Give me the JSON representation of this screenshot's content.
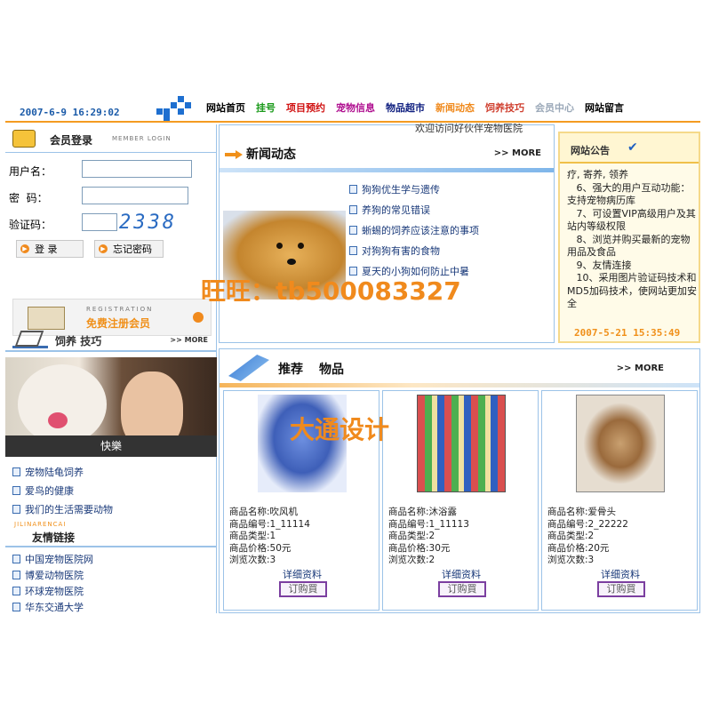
{
  "top": {
    "datetime": "2007-6-9 16:29:02",
    "nav": [
      {
        "label": "网站首页",
        "color": "#000000"
      },
      {
        "label": "挂号",
        "color": "#1a9a1a"
      },
      {
        "label": "项目预约",
        "color": "#d01010"
      },
      {
        "label": "宠物信息",
        "color": "#b01090"
      },
      {
        "label": "物品超市",
        "color": "#102080"
      },
      {
        "label": "新闻动态",
        "color": "#f08a1d"
      },
      {
        "label": "饲养技巧",
        "color": "#d04030"
      },
      {
        "label": "会员中心",
        "color": "#9aa8b8"
      },
      {
        "label": "网站留言",
        "color": "#000000"
      }
    ]
  },
  "login": {
    "title": "会员登录",
    "subtitle": "MEMBER LOGIN",
    "username_label": "用户名：",
    "password_label": "密  码：",
    "captcha_label": "验证码：",
    "captcha_text": "2338",
    "login_button": "登 录",
    "forgot_button": "忘记密码"
  },
  "register": {
    "top": "REGISTRATION",
    "main": "免费注册会员"
  },
  "tips": {
    "title_a": "饲养",
    "title_b": "技巧",
    "more": ">> MORE",
    "photo_caption": "快樂",
    "items": [
      "宠物陆龟饲养",
      "爱鸟的健康",
      "我们的生活需要动物"
    ]
  },
  "friends": {
    "subtitle": "JILINARENCAI",
    "title": "友情链接",
    "items": [
      "中国宠物医院网",
      "博爱动物医院",
      "环球宠物医院",
      "华东交通大学"
    ]
  },
  "news": {
    "welcome": "欢迎访问好伙伴宠物医院",
    "title": "新闻动态",
    "more": ">> MORE",
    "items": [
      "狗狗优生学与遗传",
      "养狗的常见错误",
      "蜥蜴的饲养应该注意的事项",
      "对狗狗有害的食物",
      "夏天的小狗如何防止中暑"
    ]
  },
  "notice": {
    "title": "网站公告",
    "body_lines": [
      "疗, 寄养, 领养",
      "   6、强大的用户互动功能：支持宠物病历库",
      "   7、可设置VIP高级用户及其站内等级权限",
      "   8、浏览并购买最新的宠物用品及食品",
      "   9、友情连接",
      "   10、采用图片验证码技术和MD5加码技术，使网站更加安全"
    ],
    "date": "2007-5-21 15:35:49"
  },
  "watermarks": {
    "line1": "旺旺：tb500083327",
    "line2": "大通设计"
  },
  "products": {
    "title_a": "推荐",
    "title_b": "物品",
    "more": ">> MORE",
    "detail_label": "详细资料",
    "order_label": "订购買",
    "items": [
      {
        "name": "商品名称:吹风机",
        "code": "商品编号:1_11114",
        "type": "商品类型:1",
        "price": "商品价格:50元",
        "views": "浏览次数:3"
      },
      {
        "name": "商品名称:沐浴露",
        "code": "商品编号:1_11113",
        "type": "商品类型:2",
        "price": "商品价格:30元",
        "views": "浏览次数:2"
      },
      {
        "name": "商品名称:爱骨头",
        "code": "商品编号:2_22222",
        "type": "商品类型:2",
        "price": "商品价格:20元",
        "views": "浏览次数:3"
      }
    ]
  }
}
